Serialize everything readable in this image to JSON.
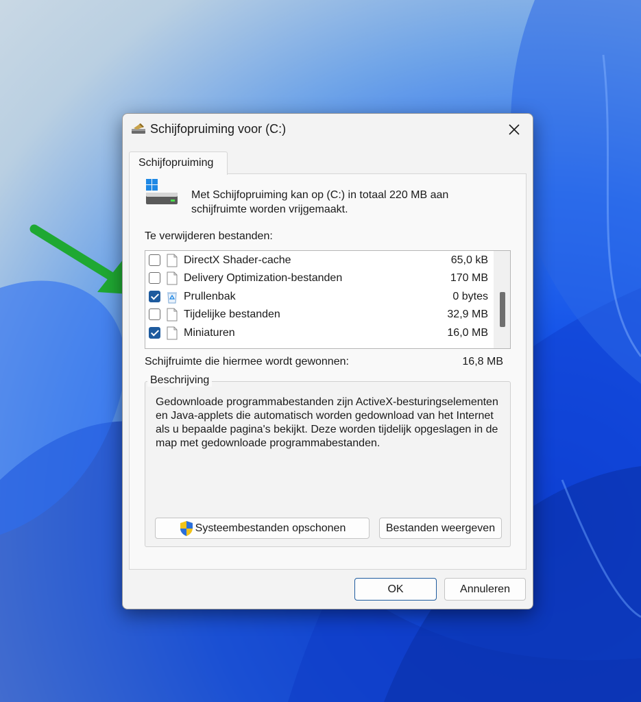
{
  "dialog": {
    "title": "Schijfopruiming voor  (C:)",
    "tab_label": "Schijfopruiming",
    "intro_text": "Met Schijfopruiming kan op  (C:) in totaal 220 MB aan schijfruimte worden vrijgemaakt.",
    "files_label": "Te verwijderen bestanden:",
    "files": [
      {
        "name": "DirectX Shader-cache",
        "size": "65,0 kB",
        "checked": false,
        "icon": "file-icon"
      },
      {
        "name": "Delivery Optimization-bestanden",
        "size": "170 MB",
        "checked": false,
        "icon": "file-icon"
      },
      {
        "name": "Prullenbak",
        "size": "0 bytes",
        "checked": true,
        "icon": "recycle-bin-icon"
      },
      {
        "name": "Tijdelijke bestanden",
        "size": "32,9 MB",
        "checked": false,
        "icon": "file-icon"
      },
      {
        "name": "Miniaturen",
        "size": "16,0 MB",
        "checked": true,
        "icon": "file-icon"
      }
    ],
    "gain_label": "Schijfruimte die hiermee wordt gewonnen:",
    "gain_value": "16,8 MB",
    "description": {
      "title": "Beschrijving",
      "text": "Gedownloade programmabestanden zijn ActiveX-besturingselementen en Java-applets die automatisch worden gedownload van het Internet als u bepaalde pagina's bekijkt. Deze worden tijdelijk opgeslagen in de map met gedownloade programmabestanden."
    },
    "buttons": {
      "system_cleanup": "Systeembestanden opschonen",
      "view_files": "Bestanden weergeven",
      "ok": "OK",
      "cancel": "Annuleren"
    }
  },
  "colors": {
    "checkbox_checked": "#1e5b9e",
    "annotation_arrow": "#1fa832",
    "wallpaper_blue": "#1553e8"
  }
}
